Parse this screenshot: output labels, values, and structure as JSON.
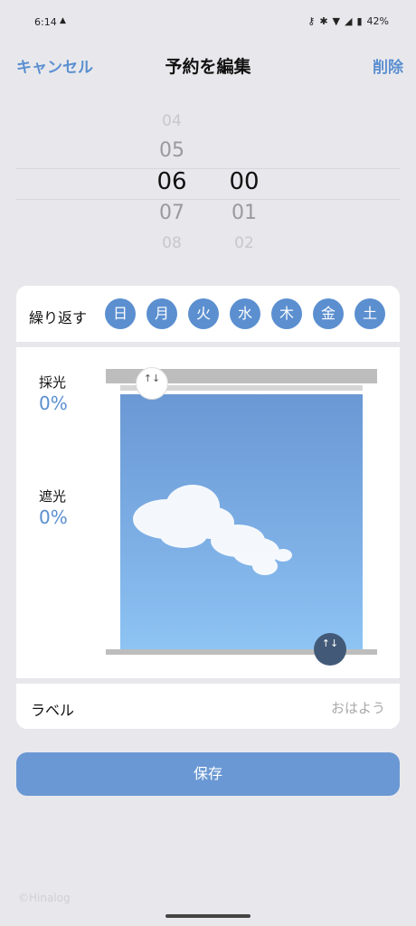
{
  "status_bar": {
    "time": "6:14",
    "time_icon": "▲",
    "icons": [
      "key-icon",
      "bluetooth-icon",
      "wifi-icon",
      "signal-icon",
      "battery-icon"
    ],
    "battery": "42%"
  },
  "header": {
    "cancel_label": "キャンセル",
    "title": "予約を編集",
    "delete_label": "削除"
  },
  "time_picker": {
    "hours": [
      "04",
      "05",
      "06",
      "07",
      "08"
    ],
    "minutes": [
      "",
      "",
      "00",
      "01",
      "02"
    ],
    "selected_hour": "06",
    "selected_minute": "00"
  },
  "repeat": {
    "label": "繰り返す",
    "days": [
      "日",
      "月",
      "火",
      "水",
      "木",
      "金",
      "土"
    ]
  },
  "window_control": {
    "daylight_label": "採光",
    "daylight_value": "0%",
    "shading_label": "遮光",
    "shading_value": "0%",
    "top_handle_icon": "↑↓",
    "bottom_handle_icon": "↑↓"
  },
  "label_row": {
    "label": "ラベル",
    "placeholder": "おはよう"
  },
  "save_button": {
    "label": "保存"
  },
  "watermark": "©Hinalog",
  "colors": {
    "accent": "#5b8fd0",
    "save_button": "#6a98d4",
    "background": "#e8e8ec",
    "bottom_handle": "#425a78"
  }
}
